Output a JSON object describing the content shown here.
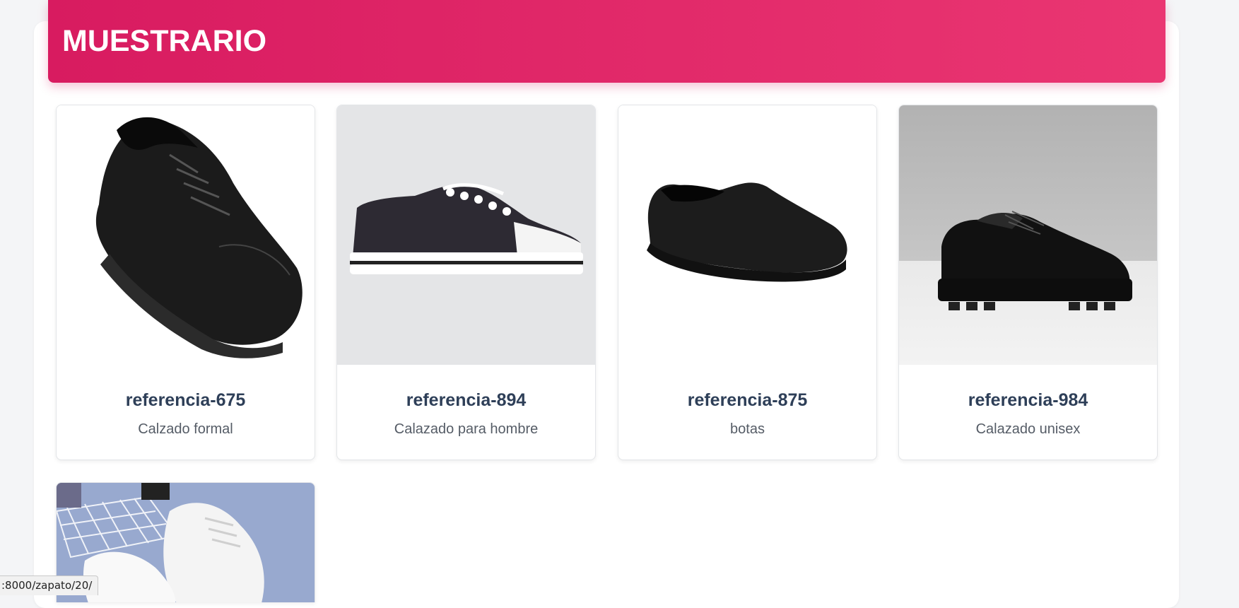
{
  "header": {
    "title": "MUESTRARIO"
  },
  "products": [
    {
      "name": "referencia-675",
      "description": "Calzado formal",
      "image_icon": "black-leather-lace-up-shoe-image"
    },
    {
      "name": "referencia-894",
      "description": "Calazado para hombre",
      "image_icon": "canvas-sneaker-image"
    },
    {
      "name": "referencia-875",
      "description": "botas",
      "image_icon": "black-slip-on-shoe-image"
    },
    {
      "name": "referencia-984",
      "description": "Calazado unisex",
      "image_icon": "black-platform-derby-shoe-image"
    },
    {
      "name": "",
      "description": "",
      "image_icon": "white-sneakers-image"
    }
  ],
  "status_bar": {
    "url": ":8000/zapato/20/"
  },
  "colors": {
    "header_start": "#d81b60",
    "header_end": "#ea3672",
    "title_text": "#2e3f58",
    "desc_text": "#555c66"
  }
}
